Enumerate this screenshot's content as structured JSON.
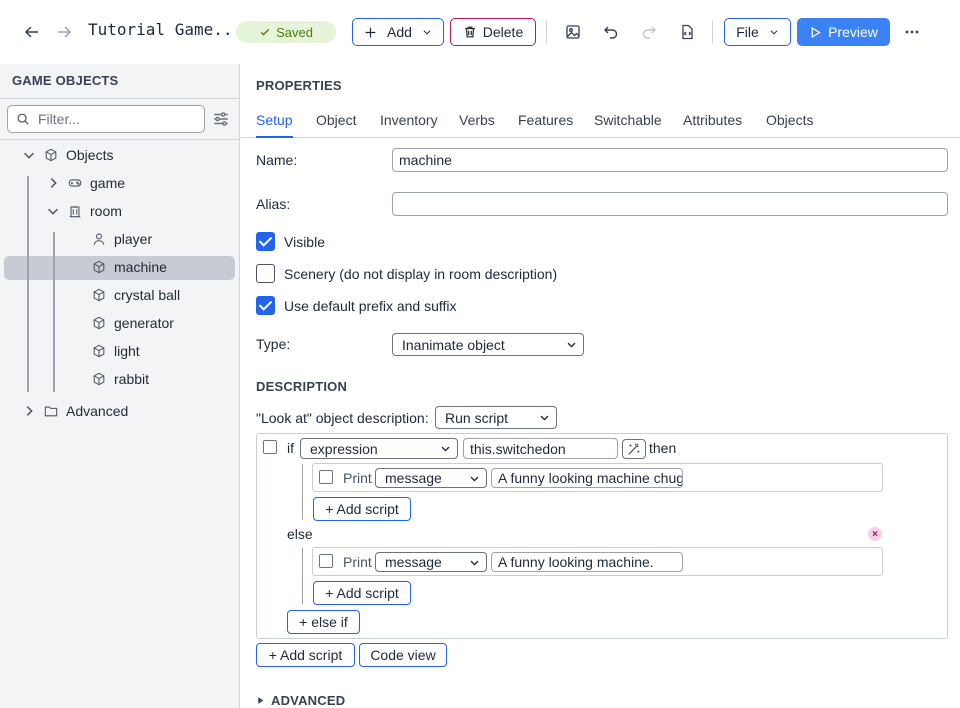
{
  "header": {
    "title": "Tutorial Game...",
    "saved_label": "Saved",
    "add_label": "Add",
    "delete_label": "Delete",
    "file_label": "File",
    "preview_label": "Preview"
  },
  "sidebar": {
    "heading": "GAME OBJECTS",
    "filter_placeholder": "Filter...",
    "tree": {
      "objects": "Objects",
      "game": "game",
      "room": "room",
      "player": "player",
      "machine": "machine",
      "crystal_ball": "crystal ball",
      "generator": "generator",
      "light": "light",
      "rabbit": "rabbit",
      "advanced": "Advanced"
    }
  },
  "properties": {
    "heading": "PROPERTIES",
    "tabs": [
      "Setup",
      "Object",
      "Inventory",
      "Verbs",
      "Features",
      "Switchable",
      "Attributes",
      "Objects"
    ],
    "active_tab": "Setup",
    "name_label": "Name:",
    "name_value": "machine",
    "alias_label": "Alias:",
    "alias_value": "",
    "visible_label": "Visible",
    "visible_checked": true,
    "scenery_label": "Scenery (do not display in room description)",
    "scenery_checked": false,
    "prefix_label": "Use default prefix and suffix",
    "prefix_checked": true,
    "type_label": "Type:",
    "type_value": "Inanimate object"
  },
  "description": {
    "heading": "DESCRIPTION",
    "look_label": "\"Look at\" object description:",
    "look_value": "Run script",
    "if_keyword": "if",
    "condition_type": "expression",
    "condition_value": "this.switchedon",
    "then_keyword": "then",
    "then_print_label": "Print",
    "then_print_type": "message",
    "then_print_value": "A funny looking machine chugs",
    "add_script_label": "+ Add script",
    "else_keyword": "else",
    "else_print_label": "Print",
    "else_print_type": "message",
    "else_print_value": "A funny looking machine.",
    "else_if_label": "+ else if",
    "code_view_label": "Code view",
    "remove_symbol": "×"
  },
  "advanced": {
    "heading": "ADVANCED"
  }
}
